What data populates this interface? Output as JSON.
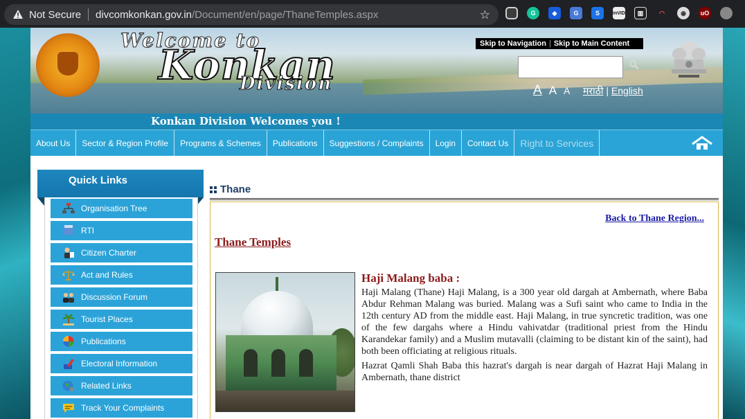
{
  "browser": {
    "security_label": "Not Secure",
    "url_host": "divcomkonkan.gov.in",
    "url_path": "/Document/en/page/ThaneTemples.aspx"
  },
  "header": {
    "welcome": "Welcome to",
    "title": "Konkan",
    "subtitle": "Division",
    "skip_nav": "Skip to Navigation",
    "skip_sep": "|",
    "skip_main": "Skip to Main Content",
    "font_large": "A",
    "font_medium": "A",
    "font_small": "A",
    "lang_marathi": "मराठी",
    "lang_sep": "|",
    "lang_english": "English",
    "welcome_strip": "Konkan Division Welcomes you !"
  },
  "nav": {
    "items": [
      {
        "label": "About Us"
      },
      {
        "label": "Sector & Region Profile"
      },
      {
        "label": "Programs & Schemes"
      },
      {
        "label": "Publications"
      },
      {
        "label": "Suggestions / Complaints"
      },
      {
        "label": "Login"
      },
      {
        "label": "Contact Us"
      },
      {
        "label": "Right to Services"
      }
    ]
  },
  "quick_links": {
    "title": "Quick Links",
    "items": [
      {
        "label": "Organisation Tree",
        "icon": "org-tree-icon"
      },
      {
        "label": "RTI",
        "icon": "rti-icon"
      },
      {
        "label": "Citizen Charter",
        "icon": "citizen-icon"
      },
      {
        "label": "Act and Rules",
        "icon": "scales-icon"
      },
      {
        "label": "Discussion Forum",
        "icon": "forum-icon"
      },
      {
        "label": "Tourist Places",
        "icon": "palm-icon"
      },
      {
        "label": "Publications",
        "icon": "globe-pub-icon"
      },
      {
        "label": "Electoral Information",
        "icon": "ballot-icon"
      },
      {
        "label": "Related Links",
        "icon": "world-link-icon"
      },
      {
        "label": "Track Your Complaints",
        "icon": "chat-icon"
      }
    ]
  },
  "article": {
    "heading": "Thane",
    "back_link": "Back to Thane Region...",
    "section_title": "Thane Temples",
    "entry_title": "Haji Malang  baba :",
    "para1": "Haji Malang (Thane) Haji Malang, is a 300 year old dargah at Ambernath, where Baba Abdur Rehman Malang was buried. Malang was a Sufi saint who came to India in the 12th century AD from the middle east. Haji Malang, in true syncretic tradition, was one of the few dargahs where a Hindu vahivatdar (traditional priest from the Hindu Karandekar family) and a Muslim mutavalli (claiming to be distant kin of the saint), had both been officiating at religious rituals.",
    "para2": "Hazrat Qamli Shah Baba this hazrat's dargah is near dargah of Hazrat Haji Malang in Ambernath, thane district"
  }
}
